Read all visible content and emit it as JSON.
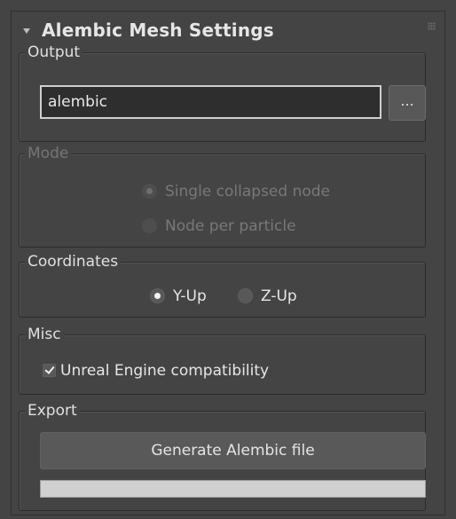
{
  "rollout": {
    "title": "Alembic Mesh Settings"
  },
  "output": {
    "label": "Output",
    "value": "alembic",
    "browse_label": "..."
  },
  "mode": {
    "label": "Mode",
    "enabled": false,
    "options": [
      {
        "label": "Single collapsed node",
        "selected": true
      },
      {
        "label": "Node per particle",
        "selected": false
      }
    ]
  },
  "coordinates": {
    "label": "Coordinates",
    "options": [
      {
        "label": "Y-Up",
        "selected": true
      },
      {
        "label": "Z-Up",
        "selected": false
      }
    ]
  },
  "misc": {
    "label": "Misc",
    "unreal_compat": {
      "label": "Unreal Engine compatibility",
      "checked": true
    }
  },
  "export": {
    "label": "Export",
    "button_label": "Generate Alembic file",
    "progress": 0
  },
  "colors": {
    "panel_bg": "#444444",
    "field_bg": "#2e2e2e",
    "button_bg": "#595959",
    "text": "#dcdcdc",
    "disabled_text": "#787878"
  }
}
